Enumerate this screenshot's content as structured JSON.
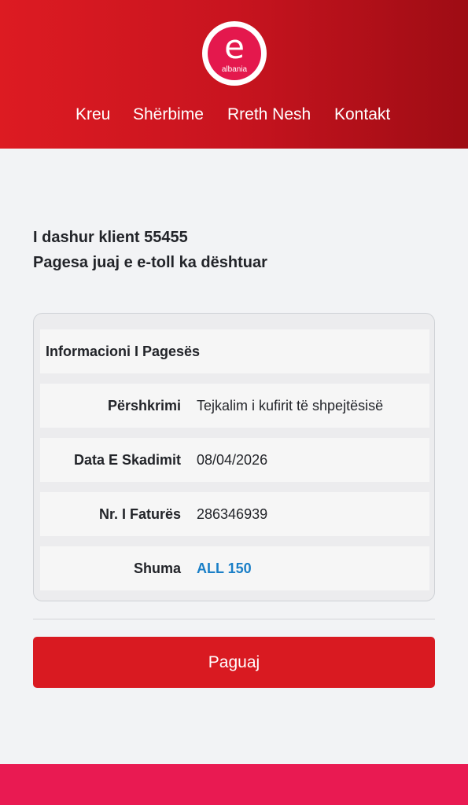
{
  "header": {
    "logo_letter": "e",
    "logo_word": "albania",
    "nav": [
      "Kreu",
      "Shërbime",
      "Rreth Nesh",
      "Kontakt"
    ]
  },
  "message": {
    "line1": "I dashur klient 55455",
    "line2": "Pagesa juaj e e-toll ka dështuar"
  },
  "payment_card": {
    "title": "Informacioni I Pagesës",
    "rows": [
      {
        "label": "Përshkrimi",
        "value": "Tejkalim i kufirit të shpejtësisë"
      },
      {
        "label": "Data E Skadimit",
        "value": "08/04/2026"
      },
      {
        "label": "Nr. I Faturës",
        "value": "286346939"
      },
      {
        "label": "Shuma",
        "value": "ALL 150"
      }
    ]
  },
  "actions": {
    "pay_label": "Paguaj"
  },
  "colors": {
    "header_red": "#dd1b22",
    "accent_pink": "#e91a52",
    "amount_blue": "#1a7fc7",
    "button_red": "#d91a21"
  }
}
